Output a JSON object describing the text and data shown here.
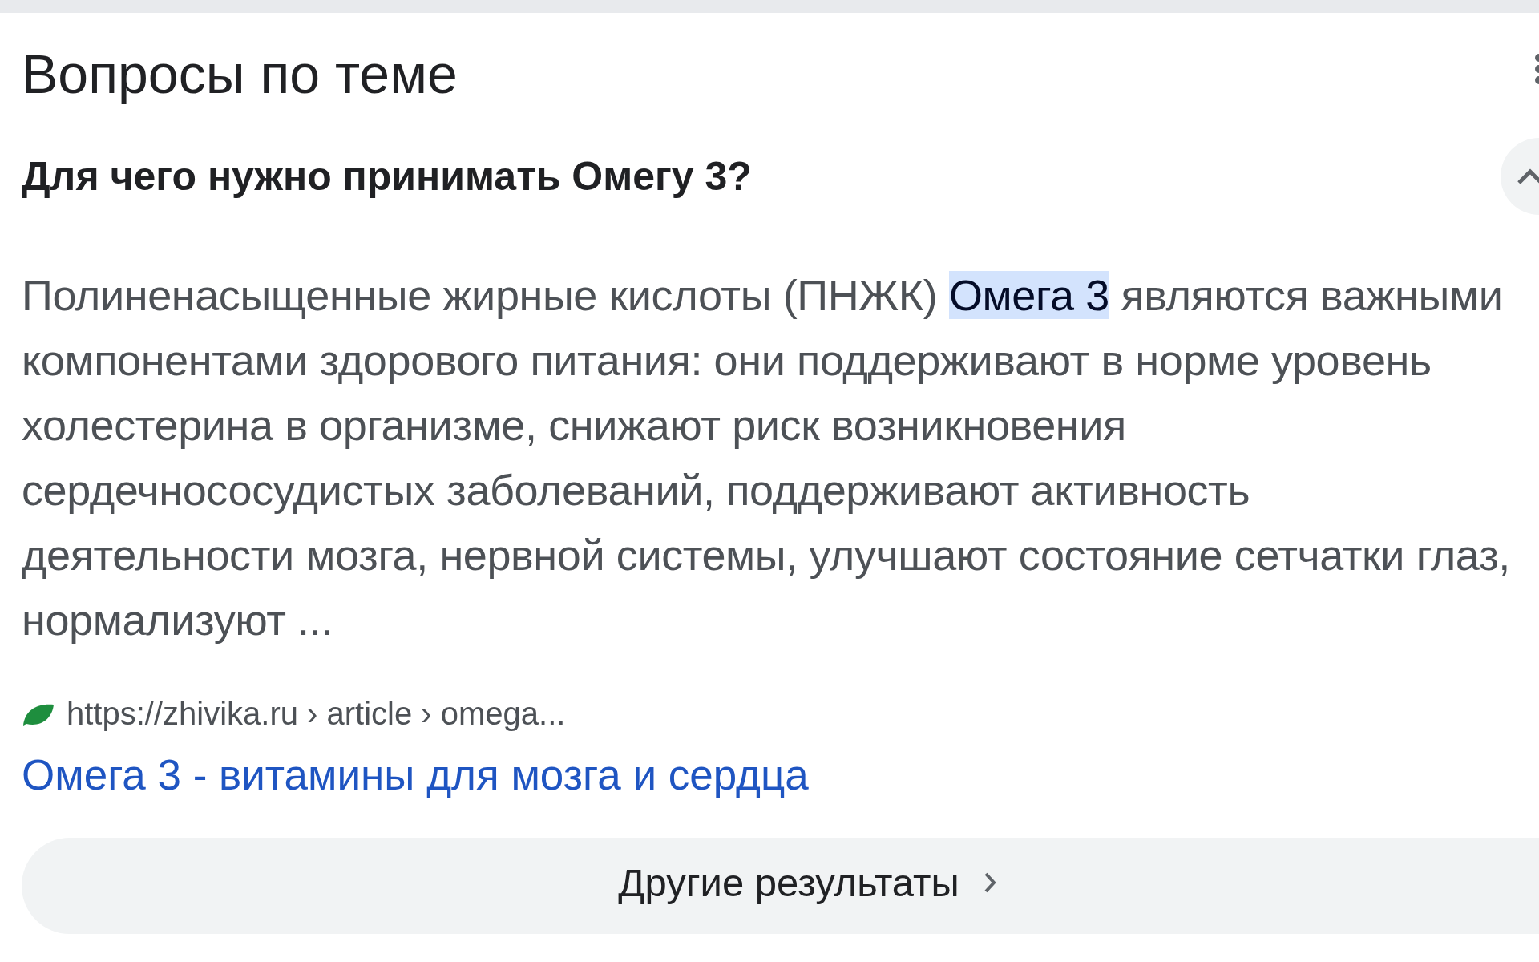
{
  "section_title": "Вопросы по теме",
  "question": {
    "text": "Для чего нужно принимать Омегу 3?",
    "expanded": true
  },
  "answer": {
    "lines": [
      [
        {
          "text": "Полиненасыщенные жирные кислоты (ПНЖК) ",
          "highlighted": false
        },
        {
          "text": "Омега 3",
          "highlighted": true
        },
        {
          "text": " являются важными",
          "highlighted": false
        }
      ],
      [
        {
          "text": "компонентами здорового питания: они поддерживают в норме уровень",
          "highlighted": false
        }
      ],
      [
        {
          "text": "холестерина в организме, снижают риск возникновения",
          "highlighted": false
        }
      ],
      [
        {
          "text": "сердечнососудистых заболеваний, поддерживают активность",
          "highlighted": false
        }
      ],
      [
        {
          "text": "деятельности мозга, нервной системы, улучшают состояние сетчатки глаз,",
          "highlighted": false
        }
      ],
      [
        {
          "text": "нормализуют ...",
          "highlighted": false
        }
      ]
    ]
  },
  "source": {
    "url": "https://zhivika.ru › article › omega...",
    "title": "Омега 3 - витамины для мозга и сердца"
  },
  "more_button": "Другие результаты"
}
